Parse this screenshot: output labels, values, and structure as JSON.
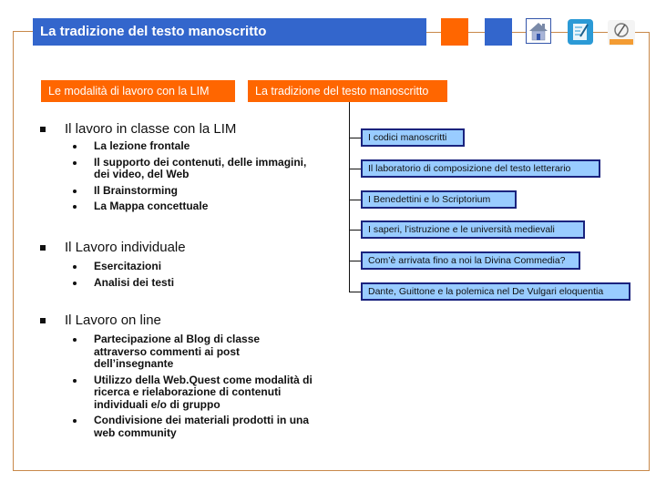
{
  "header": {
    "title": "La tradizione del testo manoscritto"
  },
  "nav_icons": [
    {
      "name": "orange-square-button",
      "color": "#ff6600"
    },
    {
      "name": "blue-square-button",
      "color": "#3366cc"
    },
    {
      "name": "home-icon"
    },
    {
      "name": "notes-icon"
    },
    {
      "name": "badge-logo-icon"
    }
  ],
  "tabs": [
    {
      "label": "Le modalità di lavoro con la LIM"
    },
    {
      "label": "La tradizione del testo manoscritto"
    }
  ],
  "sections": [
    {
      "title": "Il lavoro in classe con la LIM",
      "items": [
        "La lezione frontale",
        "Il supporto dei contenuti, delle immagini, dei video, del Web",
        "Il Brainstorming",
        "La Mappa concettuale"
      ]
    },
    {
      "title": "Il Lavoro individuale",
      "items": [
        "Esercitazioni",
        "Analisi dei testi"
      ]
    },
    {
      "title": "Il Lavoro on line",
      "items": [
        "Partecipazione al Blog di classe attraverso commenti ai post dell’insegnante",
        "Utilizzo della Web.Quest come modalità di ricerca e rielaborazione di contenuti individuali e/o di gruppo",
        "Condivisione dei materiali prodotti in una web community"
      ]
    }
  ],
  "tree_nodes": [
    "I codici manoscritti",
    "Il laboratorio di composizione del testo letterario",
    "I Benedettini e lo Scriptorium",
    "I saperi, l’istruzione e le università medievali",
    "Com’è arrivata fino a noi la Divina Commedia?",
    "Dante, Guittone e la polemica nel De Vulgari eloquentia"
  ],
  "colors": {
    "accent_orange": "#ff6600",
    "accent_blue": "#3366cc",
    "node_fill": "#99ccff",
    "node_border": "#1a237e",
    "frame": "#c8894a"
  }
}
